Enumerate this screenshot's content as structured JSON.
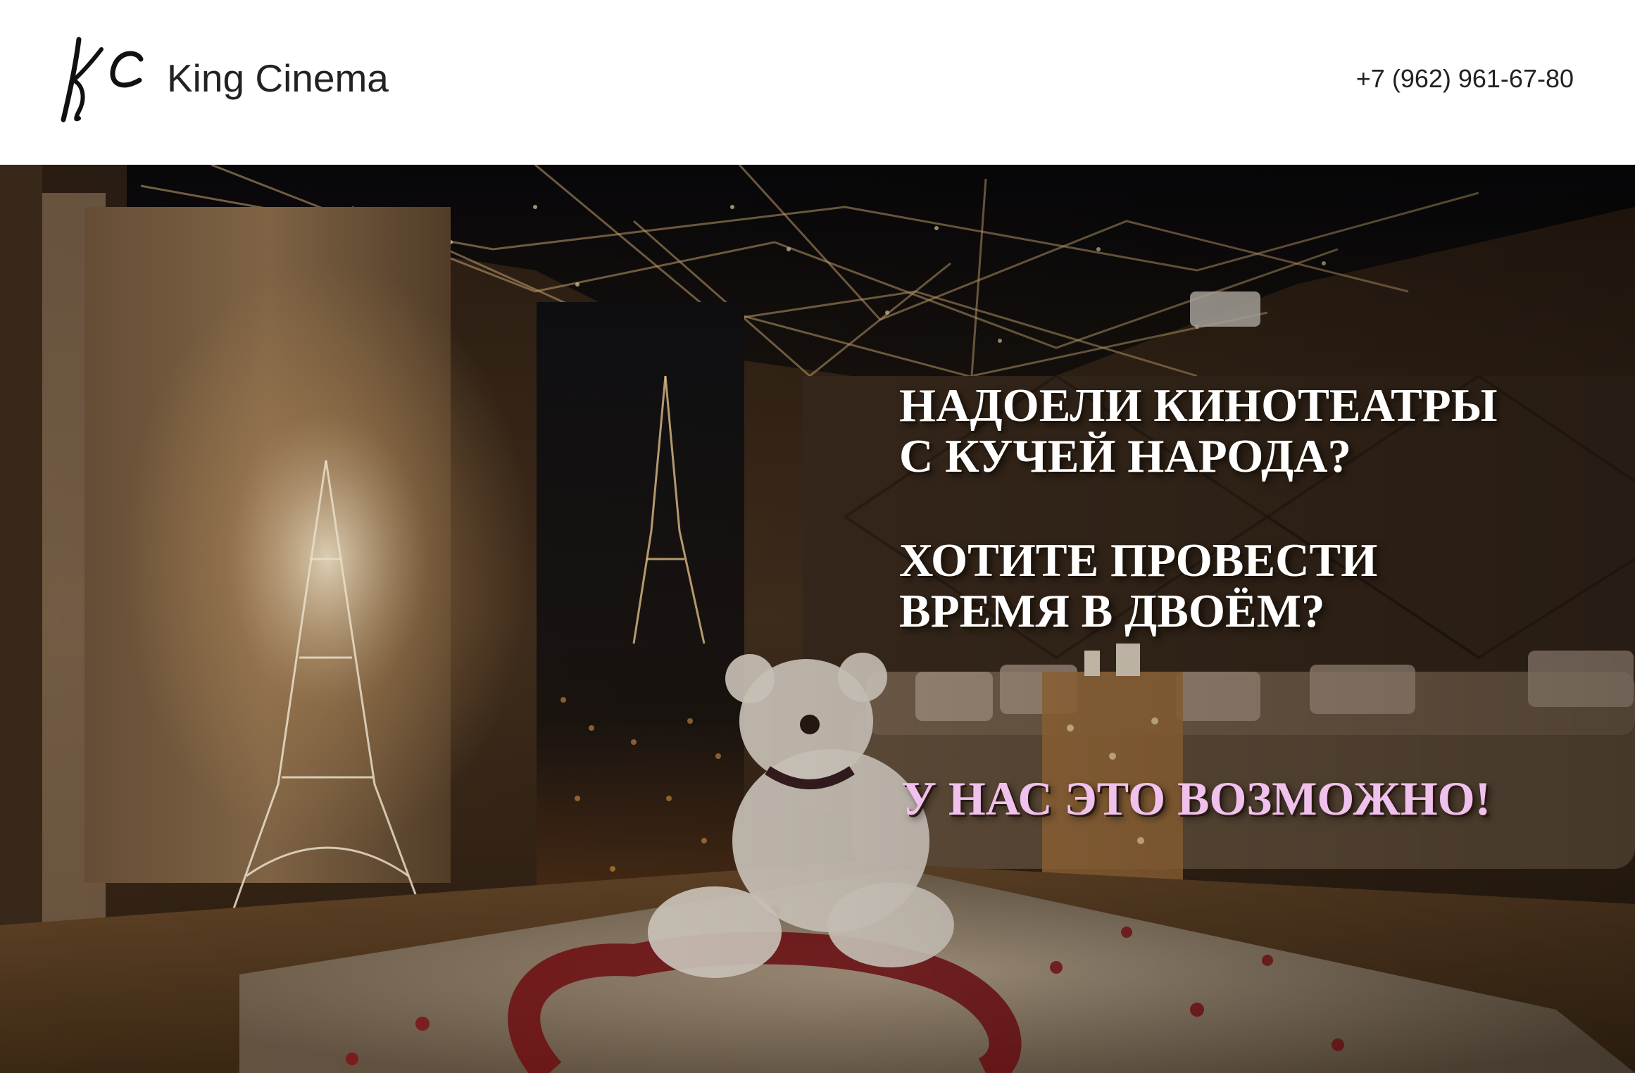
{
  "header": {
    "logo_monogram": "KC",
    "brand_name": "King Cinema",
    "phone": "+7 (962) 961-67-80"
  },
  "hero": {
    "headline_1": {
      "line_1": "НАДОЕЛИ КИНОТЕАТРЫ",
      "line_2": "С КУЧЕЙ НАРОДА?"
    },
    "headline_2": {
      "line_1": "ХОТИТЕ ПРОВЕСТИ",
      "line_2": "ВРЕМЯ В ДВОЁМ?"
    },
    "cta": "У НАС ЭТО ВОЗМОЖНО!",
    "cta_color": "#f0c1ec",
    "background_image": "romantic-cinema-room-photo"
  }
}
